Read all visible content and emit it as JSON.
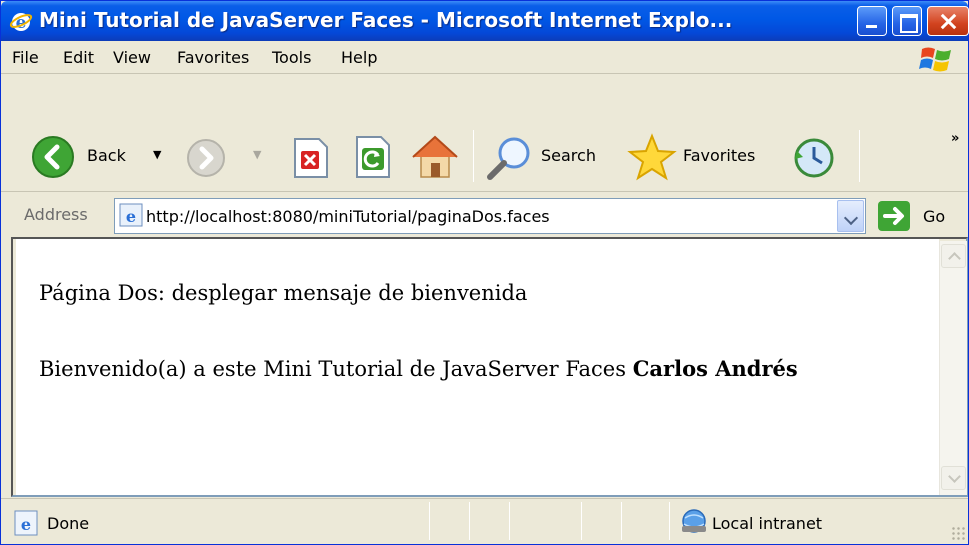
{
  "window": {
    "title": "Mini Tutorial de JavaServer Faces - Microsoft Internet Explo..."
  },
  "menu": {
    "items": [
      "File",
      "Edit",
      "View",
      "Favorites",
      "Tools",
      "Help"
    ]
  },
  "toolbar": {
    "back_label": "Back",
    "search_label": "Search",
    "favorites_label": "Favorites",
    "more_label": "»"
  },
  "address": {
    "label": "Address",
    "url": "http://localhost:8080/miniTutorial/paginaDos.faces",
    "go_label": "Go"
  },
  "page": {
    "heading": "Página Dos: desplegar mensaje de bienvenida",
    "welcome_prefix": "Bienvenido(a) a este Mini Tutorial de JavaServer Faces ",
    "user_name": "Carlos Andrés"
  },
  "status": {
    "text": "Done",
    "zone": "Local intranet"
  },
  "colors": {
    "title_bar": "#0058e6",
    "chrome": "#ece9d8",
    "close_button": "#d2431f"
  }
}
